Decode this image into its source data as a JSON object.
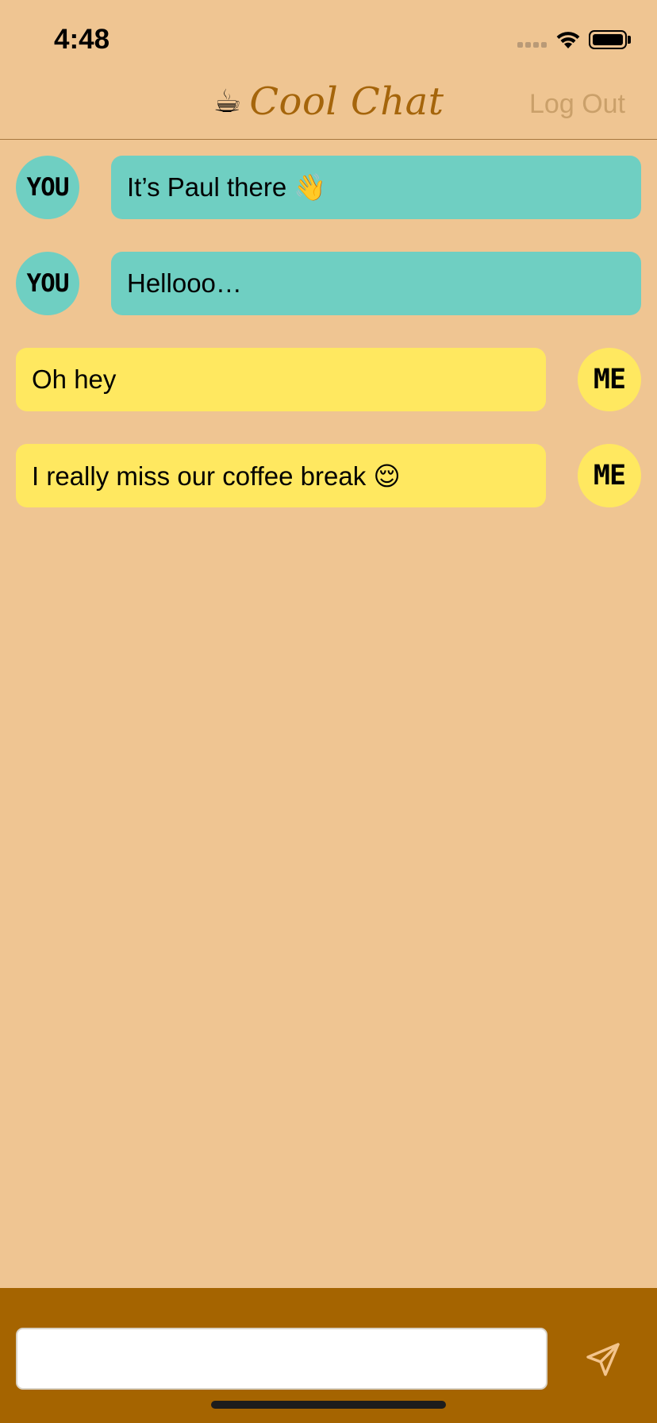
{
  "status_bar": {
    "time": "4:48"
  },
  "nav": {
    "title_icon": "☕",
    "title": "Cool Chat",
    "logout_label": "Log Out"
  },
  "messages": [
    {
      "sender": "you",
      "avatar_label": "YOU",
      "text": "It’s Paul there 👋"
    },
    {
      "sender": "you",
      "avatar_label": "YOU",
      "text": "Hellooo…"
    },
    {
      "sender": "me",
      "avatar_label": "ME",
      "text": "Oh hey"
    },
    {
      "sender": "me",
      "avatar_label": "ME",
      "text": "I really miss our coffee break 😌"
    }
  ],
  "composer": {
    "input_value": "",
    "input_placeholder": "",
    "send_icon": "send-icon"
  },
  "colors": {
    "background": "#efc592",
    "brand": "#a5650b",
    "bubble_you": "#6fcfc2",
    "bubble_me": "#ffe860",
    "input_bar": "#a56400"
  }
}
